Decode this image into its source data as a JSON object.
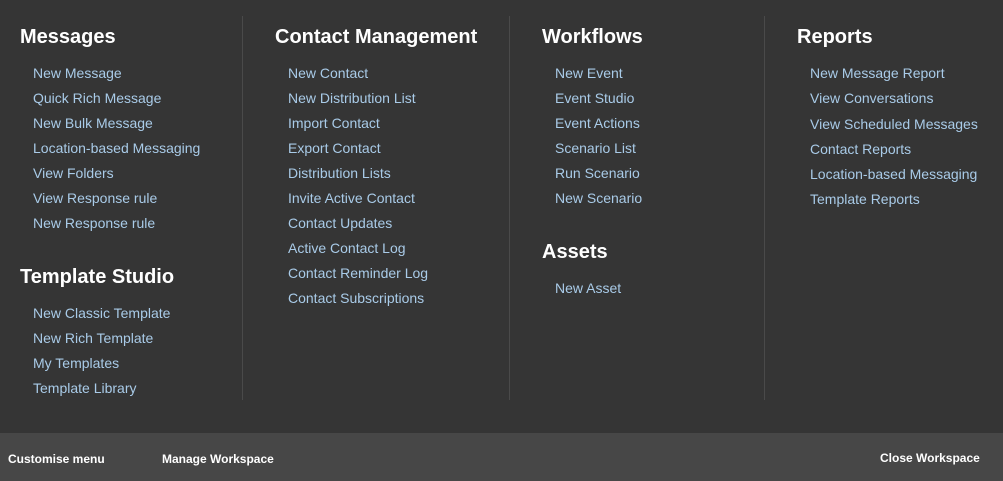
{
  "messages": {
    "heading": "Messages",
    "items": [
      "New Message",
      "Quick Rich Message",
      "New Bulk Message",
      "Location-based Messaging",
      "View Folders",
      "View Response rule",
      "New Response rule"
    ]
  },
  "template_studio": {
    "heading": "Template Studio",
    "items": [
      "New Classic Template",
      "New Rich Template",
      "My Templates",
      "Template Library"
    ]
  },
  "contact_management": {
    "heading": "Contact Management",
    "items": [
      "New Contact",
      "New Distribution List",
      "Import Contact",
      "Export Contact",
      "Distribution Lists",
      "Invite Active Contact",
      "Contact Updates",
      "Active Contact Log",
      "Contact Reminder Log",
      "Contact Subscriptions"
    ]
  },
  "workflows": {
    "heading": "Workflows",
    "items": [
      "New Event",
      "Event Studio",
      "Event Actions",
      "Scenario List",
      "Run Scenario",
      "New Scenario"
    ]
  },
  "assets": {
    "heading": "Assets",
    "items": [
      "New Asset"
    ]
  },
  "reports": {
    "heading": "Reports",
    "items": [
      "New Message Report",
      "View Conversations",
      "View Scheduled Messages",
      "Contact Reports",
      "Location-based Messaging",
      "Template Reports"
    ]
  },
  "footer": {
    "customise_menu": "Customise menu",
    "manage_workspace": "Manage Workspace",
    "close_workspace": "Close Workspace"
  },
  "colors": {
    "background": "#353535",
    "footer_background": "#474747",
    "link": "#a9cbe8",
    "heading": "#ffffff"
  }
}
